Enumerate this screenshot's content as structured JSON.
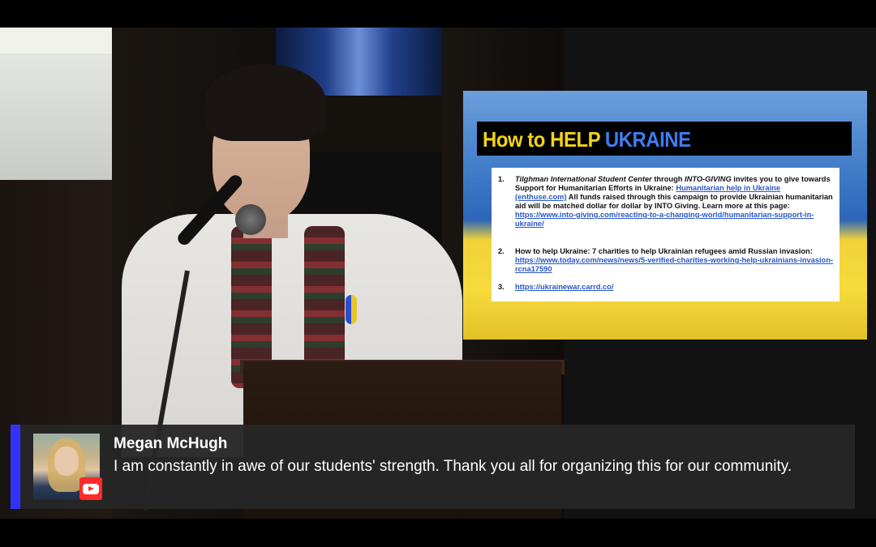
{
  "colors": {
    "accent": "#3232ff",
    "youtube_red": "#ff2b2b",
    "slide_title_yellow": "#f2d417",
    "slide_title_blue": "#3f7df0",
    "link_blue": "#2957c7"
  },
  "slide": {
    "title_part1": "How to HELP ",
    "title_part2": "UKRAINE",
    "items": [
      {
        "number": "1.",
        "org": "Tilghman International Student Center",
        "through": " through ",
        "platform": "INTO-GIVING",
        "text1": " invites you to give towards Support for Humanitarian Efforts in Ukraine: ",
        "link1": "Humanitarian help in Ukraine (enthuse.com)",
        "text2": " All funds raised through this campaign to provide Ukrainian humanitarian aid will be matched dollar for dollar by INTO Giving. Learn more at this page: ",
        "link2": "https://www.into-giving.com/reacting-to-a-changing-world/humanitarian-support-in-ukraine/"
      },
      {
        "number": "2.",
        "text": "How to help Ukraine: 7 charities to help Ukrainian refugees amid Russian invasion: ",
        "link": "https://www.today.com/news/news/5-verified-charities-working-help-ukrainians-invasion-rcna17590"
      },
      {
        "number": "3.",
        "link": "https://ukrainewar.carrd.co/"
      }
    ]
  },
  "comment": {
    "author": "Megan McHugh",
    "message": "I am constantly in awe of our students' strength. Thank you all for organizing this for our community.",
    "avatar_icon": "user-avatar",
    "badge_icon": "youtube-icon"
  }
}
